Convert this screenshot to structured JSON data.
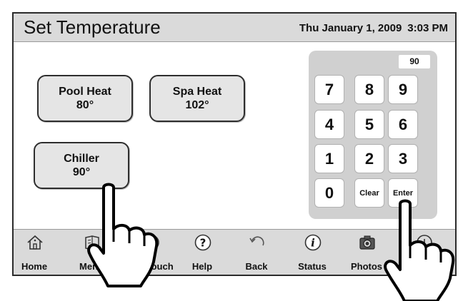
{
  "header": {
    "title": "Set Temperature",
    "date": "Thu January 1, 2009",
    "time": "3:03 PM"
  },
  "zones": [
    {
      "name": "Pool Heat",
      "temp": "80°"
    },
    {
      "name": "Spa Heat",
      "temp": "102°"
    },
    {
      "name": "Chiller",
      "temp": "90°"
    }
  ],
  "keypad": {
    "display": "90",
    "keys": [
      "7",
      "8",
      "9",
      "4",
      "5",
      "6",
      "1",
      "2",
      "3",
      "0",
      "Clear",
      "Enter"
    ]
  },
  "navbar": {
    "items": [
      {
        "label": "Home",
        "icon": "home-icon"
      },
      {
        "label": "Menu",
        "icon": "menu-icon"
      },
      {
        "label": "OneTouch",
        "icon": "onetouch-icon"
      },
      {
        "label": "Help",
        "icon": "help-icon"
      },
      {
        "label": "Back",
        "icon": "back-icon"
      },
      {
        "label": "Status",
        "icon": "status-icon"
      },
      {
        "label": "Photos",
        "icon": "camera-icon"
      },
      {
        "label": "",
        "icon": "more-icon"
      }
    ]
  },
  "overlays": [
    {
      "icon": "pointing-hand-icon",
      "target": "Chiller"
    },
    {
      "icon": "pointing-hand-icon",
      "target": "Enter"
    }
  ]
}
